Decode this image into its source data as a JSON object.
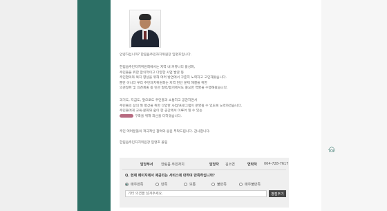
{
  "greeting": {
    "p1": "안녕하십니까? 한림읍주민자치위원장 임명호입니다.",
    "p2_lines": [
      "한림읍주민자치위원회에서는 지역 내 커뮤니티 활성화,",
      "주민들을 위한 참의적이고 다양한 사업 발굴 등",
      "주민편의와 복지 향상을 위해 여러 방면에서 꾸준히 노력하고 고민해왔습니다.",
      "뿐만 아니라 우리 주민자치위원회는 지역 현안 문제 해결을 위한",
      "의견청취 및 의견제출 등 민관 협력/협치에서도 중요한 역할을 수행해왔습니다."
    ],
    "p3_lines": [
      "과거도, 지금도, 앞으로도 주민들과 소통하고 공감하면서",
      "주민들의 삶의 질 향상을 위한 다양한 사업/프로그램이 운영될 수 있도록 노력하겠습니다.",
      "주민들에게 교육·문화와 쉼이 한 공간에서 이루어 질 수 있는"
    ],
    "p3_last": "구축을 위해 최선을 다하겠습니다.",
    "p4": "주민 여러분들의 적극적인 참여와 응원 부탁드립니다. 감사합니다.",
    "p5": "한림읍주민자치위원장 임명호 올림"
  },
  "top_button": {
    "label": "TOP",
    "arrow": "︿"
  },
  "contact": {
    "dept_label": "담당부서",
    "dept_value": "한림읍 주민자치",
    "manager_label": "담당자",
    "manager_value": "김소연",
    "phone_label": "연락처",
    "phone_value": "064-728-7617"
  },
  "survey": {
    "question": "Q. 현재 페이지에서 제공되는 서비스에 대하여 만족하십니까?",
    "options": [
      "매우만족",
      "만족",
      "보통",
      "불만족",
      "매우불만족"
    ],
    "selected": 0,
    "input_placeholder": "기타 의견을 남겨주세요.",
    "submit_label": "평점주기"
  }
}
